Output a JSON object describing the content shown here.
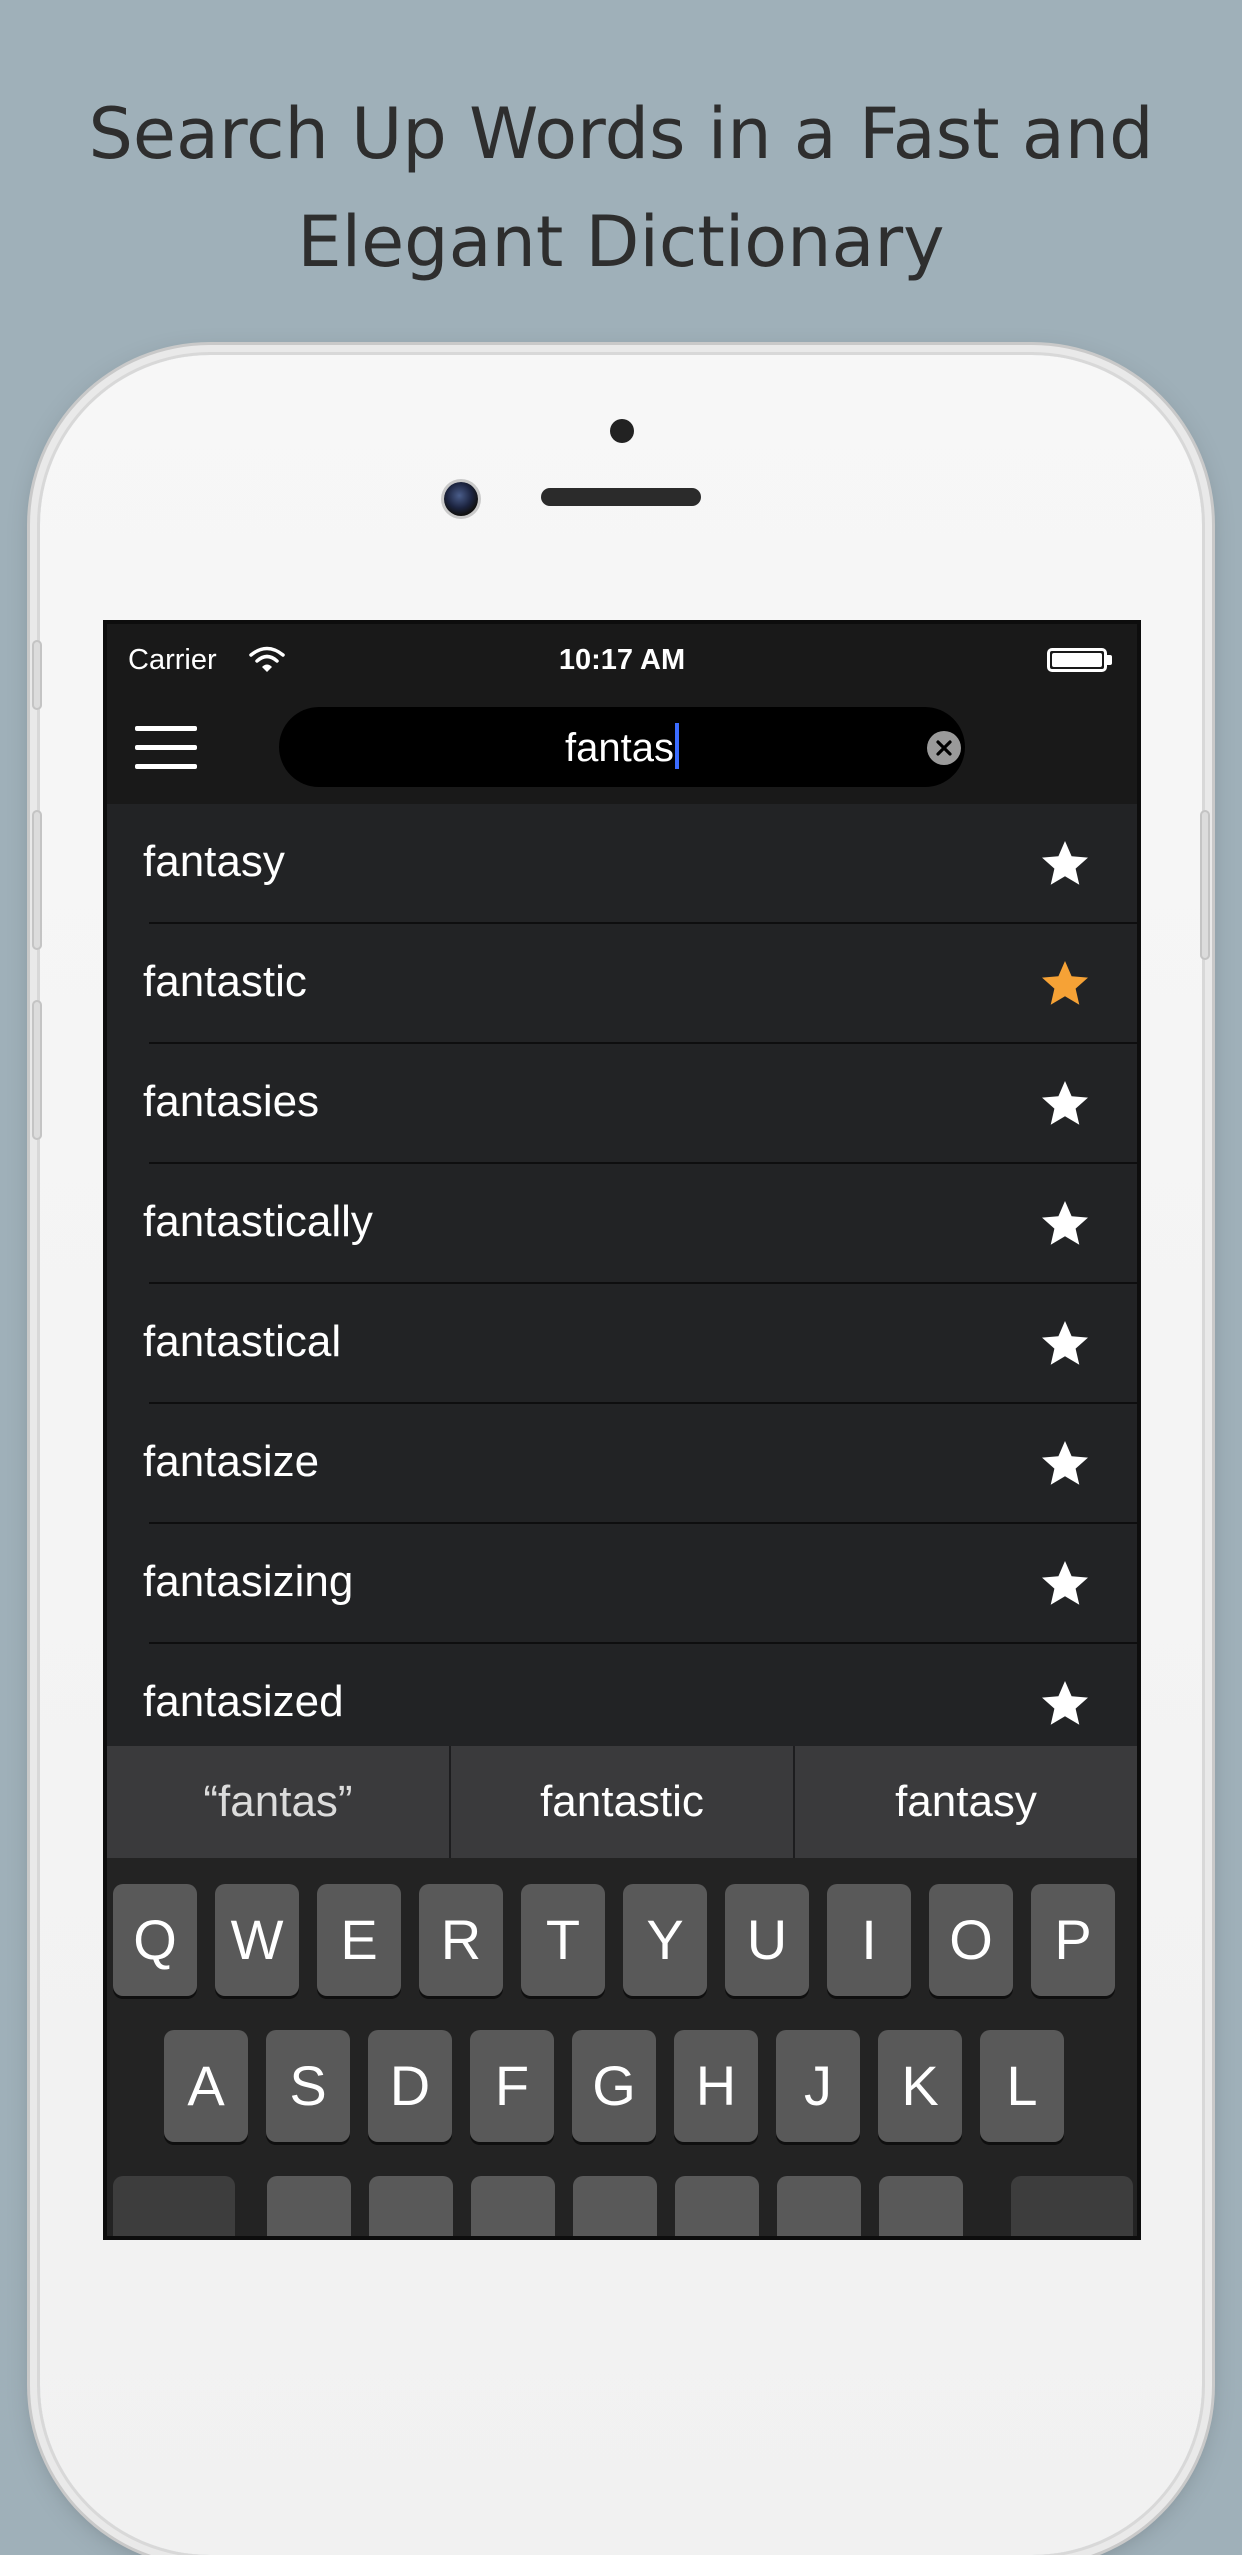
{
  "headline": {
    "line1": "Search Up Words in a Fast and",
    "line2": "Elegant Dictionary"
  },
  "status_bar": {
    "carrier": "Carrier",
    "time": "10:17 AM",
    "battery": 1.0
  },
  "search": {
    "value": "fantas"
  },
  "results": [
    {
      "word": "fantasy",
      "favorited": false
    },
    {
      "word": "fantastic",
      "favorited": true
    },
    {
      "word": "fantasies",
      "favorited": false
    },
    {
      "word": "fantastically",
      "favorited": false
    },
    {
      "word": "fantastical",
      "favorited": false
    },
    {
      "word": "fantasize",
      "favorited": false
    },
    {
      "word": "fantasizing",
      "favorited": false
    },
    {
      "word": "fantasized",
      "favorited": false
    }
  ],
  "suggestions": [
    "“fantas”",
    "fantastic",
    "fantasy"
  ],
  "keyboard": {
    "row1": [
      "Q",
      "W",
      "E",
      "R",
      "T",
      "Y",
      "U",
      "I",
      "O",
      "P"
    ],
    "row2": [
      "A",
      "S",
      "D",
      "F",
      "G",
      "H",
      "J",
      "K",
      "L"
    ]
  },
  "colors": {
    "background": "#9fb0b9",
    "row_background": "#222325",
    "star_default": "#ffffff",
    "star_favorite": "#f6a236",
    "caret": "#3b6cff"
  }
}
